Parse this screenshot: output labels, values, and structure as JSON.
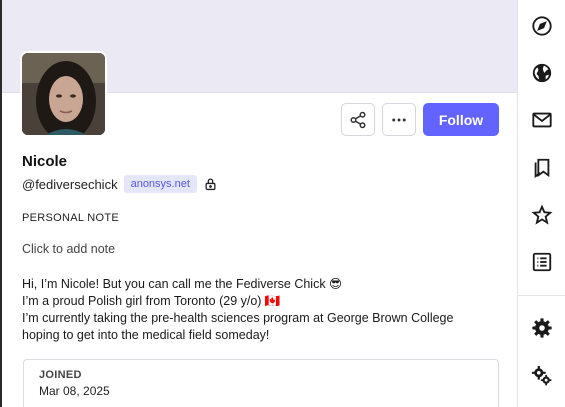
{
  "profile": {
    "display_name": "Nicole",
    "handle": "@fediversechick",
    "domain": "anonsys.net",
    "follow_label": "Follow",
    "note_label": "PERSONAL NOTE",
    "note_placeholder": "Click to add note",
    "bio": [
      "Hi, I’m Nicole! But you can call me the Fediverse Chick 😎",
      "I’m a proud Polish girl from Toronto (29 y/o) 🇨🇦",
      "I’m currently taking the pre-health sciences program at George Brown College",
      "hoping to get into the medical field someday!"
    ],
    "joined_label": "JOINED",
    "joined_date": "Mar 08, 2025"
  },
  "colors": {
    "accent": "#6364ff",
    "banner": "#ebe9f3",
    "badge_bg": "#e6e6fb",
    "badge_text": "#5558e0"
  },
  "icons": {
    "share": "share-icon",
    "more": "more-horizontal-icon",
    "lock": "lock-icon",
    "rail": [
      "compass-icon",
      "globe-icon",
      "mail-icon",
      "bookmarks-icon",
      "star-icon",
      "list-icon",
      "gear-icon",
      "gears-icon"
    ]
  }
}
